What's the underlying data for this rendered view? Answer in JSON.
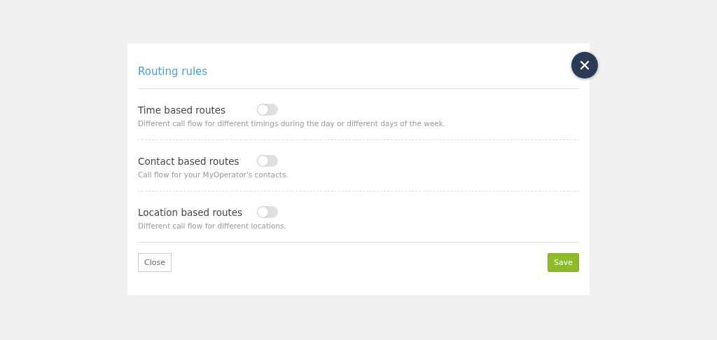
{
  "dialog": {
    "title": "Routing rules"
  },
  "rules": [
    {
      "label": "Time based routes",
      "on": false,
      "description": "Different call flow for different timings during the day or different days of the week."
    },
    {
      "label": "Contact based routes",
      "on": false,
      "description": "Call flow for your MyOperator's contacts."
    },
    {
      "label": "Location based routes",
      "on": false,
      "description": "Different call flow for different locations."
    }
  ],
  "buttons": {
    "close": "Close",
    "save": "Save"
  }
}
